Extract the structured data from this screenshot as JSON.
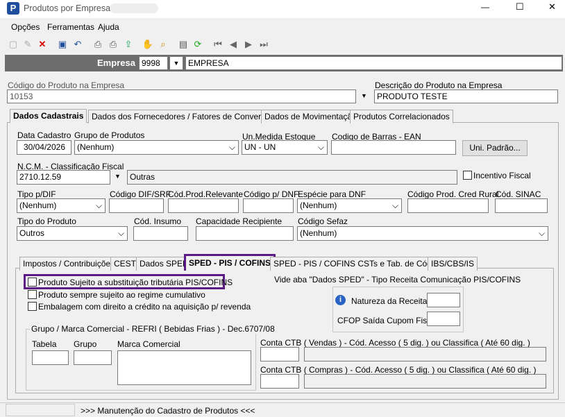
{
  "window": {
    "title": "Produtos por Empresa",
    "minimize": "—",
    "maximize": "☐",
    "close": "✕"
  },
  "menu": [
    "Opções",
    "Ferramentas",
    "Ajuda"
  ],
  "toolbar_icons": [
    "new-icon",
    "edit-icon",
    "delete-icon",
    "save-icon",
    "undo-icon",
    "print-icon",
    "print-preview-icon",
    "export-icon",
    "hand-icon",
    "search-icon",
    "properties-icon",
    "refresh-icon",
    "first-icon",
    "prev-icon",
    "next-icon",
    "last-icon"
  ],
  "empresa": {
    "label": "Empresa",
    "code": "9998",
    "name": "EMPRESA"
  },
  "codigo": {
    "label": "Código do Produto na Empresa",
    "value": "10153"
  },
  "descricao": {
    "label": "Descrição do Produto na Empresa",
    "value": "PRODUTO TESTE"
  },
  "main_tabs": [
    "Dados Cadastrais",
    "Dados dos Fornecedores / Fatores de Conversão",
    "Dados de Movimentação",
    "Produtos Correlacionados"
  ],
  "fields": {
    "data_cadastro": {
      "label": "Data Cadastro",
      "value": "30/04/2026"
    },
    "grupo": {
      "label": "Grupo de Produtos",
      "value": "(Nenhum)"
    },
    "un_medida": {
      "label": "Un.Medida Estoque",
      "value": "UN - UN"
    },
    "ean": {
      "label": "Codigo de Barras - EAN",
      "value": ""
    },
    "uni_padrao": "Uni. Padrão...",
    "ncm": {
      "label": "N.C.M. -  Classificação Fiscal",
      "value": "2710.12.59",
      "desc": "Outras"
    },
    "incentivo": "Incentivo Fiscal",
    "tipo_dif": {
      "label": "Tipo p/DIF",
      "value": "(Nenhum)"
    },
    "codigo_dif": {
      "label": "Código DIF/SRF"
    },
    "cod_relevante": {
      "label": "Cód.Prod.Relevante"
    },
    "codigo_dnf": {
      "label": "Código p/ DNF"
    },
    "especie_dnf": {
      "label": "Espécie para DNF",
      "value": "(Nenhum)"
    },
    "cred_rural": {
      "label": "Código Prod. Cred Rural"
    },
    "sinac": {
      "label": "Cód. SINAC"
    },
    "tipo_produto": {
      "label": "Tipo do Produto",
      "value": "Outros"
    },
    "cod_insumo": {
      "label": "Cód. Insumo"
    },
    "capacidade": {
      "label": "Capacidade Recipiente"
    },
    "cod_sefaz": {
      "label": "Código Sefaz",
      "value": "(Nenhum)"
    }
  },
  "sub_tabs": [
    "Impostos / Contribuições",
    "CEST",
    "Dados SPED",
    "SPED - PIS / COFINS",
    "SPED - PIS / COFINS CSTs e Tab. de Códigos",
    "IBS/CBS/IS"
  ],
  "sped": {
    "chk1": "Produto Sujeito a substituição tributária PIS/COFINS",
    "chk2": "Produto sempre sujeito ao regime cumulativo",
    "chk3": "Embalagem com direito a crédito na aquisição p/ revenda",
    "vide": "Vide aba \"Dados SPED\" - Tipo Receita Comunicação PIS/COFINS",
    "natureza": "Natureza da Receita:",
    "cfop": "CFOP Saída Cupom Fiscal:",
    "group_title": "Grupo / Marca Comercial - REFRI ( Bebidas Frias ) - Dec.6707/08",
    "tabela": "Tabela",
    "grupo": "Grupo",
    "marca": "Marca Comercial",
    "ctb_vendas": "Conta CTB ( Vendas ) - Cód. Acesso ( 5 dig. ) ou Classifica ( Até 60 dig. )",
    "ctb_compras": "Conta CTB ( Compras ) - Cód. Acesso ( 5 dig. ) ou Classifica ( Até 60 dig. )"
  },
  "status": ">>> Manutenção do Cadastro de Produtos <<<",
  "colors": {
    "accent": "#1f4e9c",
    "highlight": "#5b1a86"
  }
}
